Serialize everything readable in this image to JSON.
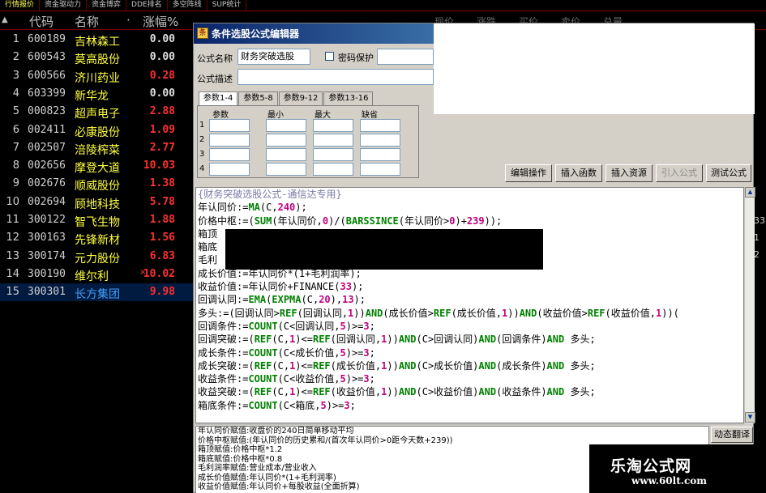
{
  "top_tabs": [
    "行情报价",
    "资金驱动力",
    "资金博弈",
    "DDE排名",
    "多空阵线",
    "SUP统计"
  ],
  "list_header": {
    "code": "代码",
    "name": "名称",
    "dot": "·",
    "change_pct": "涨幅%",
    "ghost_cols": [
      "现价",
      "涨跌",
      "买价",
      "卖价",
      "总量"
    ]
  },
  "stocks": [
    {
      "idx": "1",
      "code": "600189",
      "name": "吉林森工",
      "pct": "0.00",
      "color": "#e0e0e0"
    },
    {
      "idx": "2",
      "code": "600543",
      "name": "莫高股份",
      "pct": "0.00",
      "color": "#e0e0e0"
    },
    {
      "idx": "3",
      "code": "600566",
      "name": "济川药业",
      "pct": "0.28",
      "color": "#ff3030"
    },
    {
      "idx": "4",
      "code": "603399",
      "name": "新华龙",
      "pct": "0.00",
      "color": "#e0e0e0"
    },
    {
      "idx": "5",
      "code": "000823",
      "name": "超声电子",
      "pct": "2.88",
      "color": "#ff3030"
    },
    {
      "idx": "6",
      "code": "002411",
      "name": "必康股份",
      "pct": "1.09",
      "color": "#ff3030"
    },
    {
      "idx": "7",
      "code": "002507",
      "name": "涪陵榨菜",
      "pct": "2.77",
      "color": "#ff3030"
    },
    {
      "idx": "8",
      "code": "002656",
      "name": "摩登大道",
      "pct": "10.03",
      "color": "#ff3030"
    },
    {
      "idx": "9",
      "code": "002676",
      "name": "顺威股份",
      "pct": "1.38",
      "color": "#ff3030"
    },
    {
      "idx": "10",
      "code": "002694",
      "name": "顾地科技",
      "pct": "5.78",
      "color": "#ff3030"
    },
    {
      "idx": "11",
      "code": "300122",
      "name": "智飞生物",
      "pct": "1.88",
      "color": "#ff3030"
    },
    {
      "idx": "12",
      "code": "300163",
      "name": "先锋新材",
      "pct": "1.56",
      "color": "#ff3030"
    },
    {
      "idx": "13",
      "code": "300174",
      "name": "元力股份",
      "pct": "6.83",
      "color": "#ff3030"
    },
    {
      "idx": "14",
      "code": "300190",
      "name": "维尔利",
      "pct": "10.02",
      "color": "#ff3030",
      "mark": "×"
    },
    {
      "idx": "15",
      "code": "300301",
      "name": "长方集团",
      "pct": "9.98",
      "color": "#ff3030",
      "selected": true
    }
  ],
  "right_edge_values": [
    "33",
    "1",
    "2"
  ],
  "editor": {
    "title": "条件选股公式编辑器",
    "name_label": "公式名称",
    "name_value": "财务突破选股",
    "password_label": "密码保护",
    "desc_label": "公式描述",
    "desc_value": "",
    "tabs": [
      "参数1-4",
      "参数5-8",
      "参数9-12",
      "参数13-16"
    ],
    "param_headers": [
      "参数",
      "最小",
      "最大",
      "缺省"
    ],
    "param_rows": [
      "1",
      "2",
      "3",
      "4"
    ],
    "buttons": {
      "edit_ops": "编辑操作",
      "insert_func": "插入函数",
      "insert_res": "插入资源",
      "import_formula": "引入公式",
      "test_formula": "测试公式"
    },
    "code_comment": "{财务突破选股公式-通信达专用}",
    "code_lines": [
      {
        "segs": [
          [
            "t",
            "年认同价:="
          ],
          [
            "f",
            "MA"
          ],
          [
            "t",
            "(C,"
          ],
          [
            "n",
            "240"
          ],
          [
            "t",
            ");"
          ]
        ]
      },
      {
        "segs": [
          [
            "t",
            "价格中枢:=("
          ],
          [
            "f",
            "SUM"
          ],
          [
            "t",
            "(年认同价,"
          ],
          [
            "n",
            "0"
          ],
          [
            "t",
            ")/("
          ],
          [
            "f",
            "BARSSINCE"
          ],
          [
            "t",
            "(年认同价>"
          ],
          [
            "n",
            "0"
          ],
          [
            "t",
            ")+"
          ],
          [
            "n",
            "239"
          ],
          [
            "t",
            "));"
          ]
        ]
      },
      {
        "segs": [
          [
            "t",
            "箱顶"
          ]
        ]
      },
      {
        "segs": [
          [
            "t",
            "箱底"
          ]
        ]
      },
      {
        "segs": [
          [
            "t",
            "毛利"
          ]
        ]
      },
      {
        "segs": [
          [
            "t",
            "成长价值:=年认同价*(1+毛利润率);"
          ]
        ]
      },
      {
        "segs": [
          [
            "t",
            "收益价值:=年认同价+FINANCE("
          ],
          [
            "n",
            "33"
          ],
          [
            "t",
            ");"
          ]
        ]
      },
      {
        "segs": [
          [
            "t",
            "回调认同:="
          ],
          [
            "f",
            "EMA"
          ],
          [
            "t",
            "("
          ],
          [
            "f",
            "EXPMA"
          ],
          [
            "t",
            "(C,"
          ],
          [
            "n",
            "20"
          ],
          [
            "t",
            "),"
          ],
          [
            "n",
            "13"
          ],
          [
            "t",
            ");"
          ]
        ]
      },
      {
        "segs": [
          [
            "t",
            "多头:=(回调认同>"
          ],
          [
            "f",
            "REF"
          ],
          [
            "t",
            "(回调认同,"
          ],
          [
            "n",
            "1"
          ],
          [
            "t",
            "))"
          ],
          [
            "k",
            "AND"
          ],
          [
            "t",
            "(成长价值>"
          ],
          [
            "f",
            "REF"
          ],
          [
            "t",
            "(成长价值,"
          ],
          [
            "n",
            "1"
          ],
          [
            "t",
            "))"
          ],
          [
            "k",
            "AND"
          ],
          [
            "t",
            "(收益价值>"
          ],
          [
            "f",
            "REF"
          ],
          [
            "t",
            "(收益价值,"
          ],
          [
            "n",
            "1"
          ],
          [
            "t",
            "))("
          ]
        ]
      },
      {
        "segs": [
          [
            "t",
            "回调条件:="
          ],
          [
            "f",
            "COUNT"
          ],
          [
            "t",
            "(C<回调认同,"
          ],
          [
            "n",
            "5"
          ],
          [
            "t",
            ")>="
          ],
          [
            "n",
            "3"
          ],
          [
            "t",
            ";"
          ]
        ]
      },
      {
        "segs": [
          [
            "t",
            "回调突破:=("
          ],
          [
            "f",
            "REF"
          ],
          [
            "t",
            "(C,"
          ],
          [
            "n",
            "1"
          ],
          [
            "t",
            ")<="
          ],
          [
            "f",
            "REF"
          ],
          [
            "t",
            "(回调认同,"
          ],
          [
            "n",
            "1"
          ],
          [
            "t",
            "))"
          ],
          [
            "k",
            "AND"
          ],
          [
            "t",
            "(C>回调认同)"
          ],
          [
            "k",
            "AND"
          ],
          [
            "t",
            "(回调条件)"
          ],
          [
            "k",
            "AND"
          ],
          [
            "t",
            " 多头;"
          ]
        ]
      },
      {
        "segs": [
          [
            "t",
            "成长条件:="
          ],
          [
            "f",
            "COUNT"
          ],
          [
            "t",
            "(C<成长价值,"
          ],
          [
            "n",
            "5"
          ],
          [
            "t",
            ")>="
          ],
          [
            "n",
            "3"
          ],
          [
            "t",
            ";"
          ]
        ]
      },
      {
        "segs": [
          [
            "t",
            "成长突破:=("
          ],
          [
            "f",
            "REF"
          ],
          [
            "t",
            "(C,"
          ],
          [
            "n",
            "1"
          ],
          [
            "t",
            ")<="
          ],
          [
            "f",
            "REF"
          ],
          [
            "t",
            "(成长价值,"
          ],
          [
            "n",
            "1"
          ],
          [
            "t",
            "))"
          ],
          [
            "k",
            "AND"
          ],
          [
            "t",
            "(C>成长价值)"
          ],
          [
            "k",
            "AND"
          ],
          [
            "t",
            "(成长条件)"
          ],
          [
            "k",
            "AND"
          ],
          [
            "t",
            " 多头;"
          ]
        ]
      },
      {
        "segs": [
          [
            "t",
            "收益条件:="
          ],
          [
            "f",
            "COUNT"
          ],
          [
            "t",
            "(C<收益价值,"
          ],
          [
            "n",
            "5"
          ],
          [
            "t",
            ")>="
          ],
          [
            "n",
            "3"
          ],
          [
            "t",
            ";"
          ]
        ]
      },
      {
        "segs": [
          [
            "t",
            "收益突破:=("
          ],
          [
            "f",
            "REF"
          ],
          [
            "t",
            "(C,"
          ],
          [
            "n",
            "1"
          ],
          [
            "t",
            ")<="
          ],
          [
            "f",
            "REF"
          ],
          [
            "t",
            "(收益价值,"
          ],
          [
            "n",
            "1"
          ],
          [
            "t",
            "))"
          ],
          [
            "k",
            "AND"
          ],
          [
            "t",
            "(C>收益价值)"
          ],
          [
            "k",
            "AND"
          ],
          [
            "t",
            "(收益条件)"
          ],
          [
            "k",
            "AND"
          ],
          [
            "t",
            " 多头;"
          ]
        ]
      },
      {
        "segs": [
          [
            "t",
            "箱底条件:="
          ],
          [
            "f",
            "COUNT"
          ],
          [
            "t",
            "(C<箱底,"
          ],
          [
            "n",
            "5"
          ],
          [
            "t",
            ")>="
          ],
          [
            "n",
            "3"
          ],
          [
            "t",
            ";"
          ]
        ]
      }
    ],
    "desc_lines": [
      "年认同价赋值:收盘价的240日简单移动平均",
      "价格中枢赋值:(年认同价的历史累和/(首次年认同价>0距今天数+239))",
      "箱顶赋值:价格中枢*1.2",
      "箱底赋值:价格中枢*0.8",
      "毛利润率赋值:营业成本/营业收入",
      "成长价值赋值:年认同价*(1+毛利润率)",
      "收益价值赋值:年认同价+每股收益(全面折算)"
    ],
    "dynamic_translate": "动态翻译"
  },
  "watermark": {
    "title": "乐淘公式网",
    "url": "www.60lt.com"
  }
}
